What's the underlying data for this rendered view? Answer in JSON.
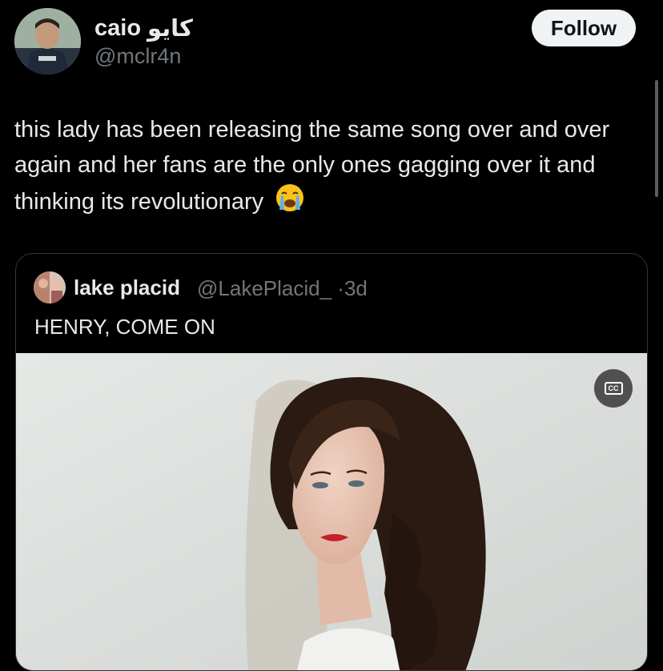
{
  "author": {
    "display_name": "caio",
    "display_name_arabic": "كايو",
    "handle": "@mclr4n",
    "avatar_icon": "profile-photo-icon"
  },
  "follow_label": "Follow",
  "tweet": {
    "text": "this lady has been releasing the same song over and over again and her fans are the only ones gagging over it and thinking its revolutionary",
    "emoji": "loudly-crying-face-icon"
  },
  "quote": {
    "display_name": "lake placid",
    "handle": "@LakePlacid_",
    "separator": "·",
    "time": "3d",
    "text": "HENRY, COME ON",
    "cc_label": "CC"
  },
  "colors": {
    "background": "#000000",
    "primary_text": "#e7e9ea",
    "secondary_text": "#71767b",
    "border": "#333639",
    "follow_bg": "#eff3f4"
  }
}
